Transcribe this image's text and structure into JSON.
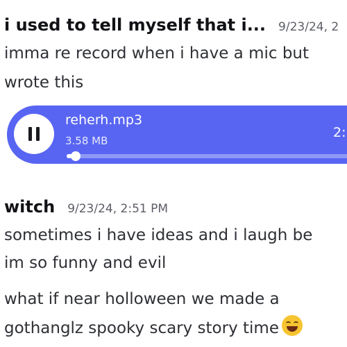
{
  "messages": [
    {
      "username": "i used to tell myself that i...",
      "timestamp": "9/23/24, 2",
      "lines": [
        "imma re record when i have a mic but",
        "wrote this"
      ]
    },
    {
      "username": "witch",
      "timestamp": "9/23/24, 2:51 PM",
      "lines": [
        "sometimes i have ideas and i laugh be",
        "im so funny and evil"
      ]
    }
  ],
  "continuation": {
    "lines": [
      "what if near holloween we made a",
      "gothanglz spooky scary story time"
    ],
    "emoji": "face-with-tears-of-joy"
  },
  "attachment": {
    "file_name": "reherh.mp3",
    "file_size": "3.58 MB",
    "duration": "2:",
    "progress": 0.03,
    "state": "playing",
    "accent_color": "#5865f2"
  }
}
